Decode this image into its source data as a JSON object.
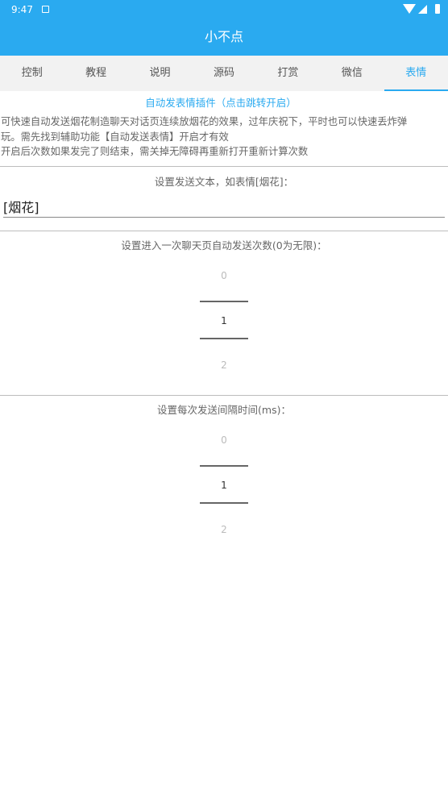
{
  "status_bar": {
    "time": "9:47"
  },
  "app_bar": {
    "title": "小不点"
  },
  "tabs": [
    {
      "label": "控制",
      "active": false
    },
    {
      "label": "教程",
      "active": false
    },
    {
      "label": "说明",
      "active": false
    },
    {
      "label": "源码",
      "active": false
    },
    {
      "label": "打赏",
      "active": false
    },
    {
      "label": "微信",
      "active": false
    },
    {
      "label": "表情",
      "active": true
    }
  ],
  "plugin": {
    "link_text": "自动发表情插件（点击跳转开启）",
    "description": [
      "可快速自动发送烟花制造聊天对话页连续放烟花的效果，过年庆祝下，平时也可以快速丢炸弹",
      "玩。需先找到辅助功能【自动发送表情】开启才有效",
      "开启后次数如果发完了则结束，需关掉无障碍再重新打开重新计算次数"
    ]
  },
  "send_text": {
    "label": "设置发送文本，如表情[烟花]：",
    "value": "[烟花]"
  },
  "send_count": {
    "label": "设置进入一次聊天页自动发送次数(0为无限)：",
    "prev": "0",
    "selected": "1",
    "next": "2"
  },
  "send_interval": {
    "label": "设置每次发送间隔时间(ms)：",
    "prev": "0",
    "selected": "1",
    "next": "2"
  },
  "colors": {
    "primary": "#2aaaf0",
    "tab_bar_bg": "#f2f2f2"
  }
}
